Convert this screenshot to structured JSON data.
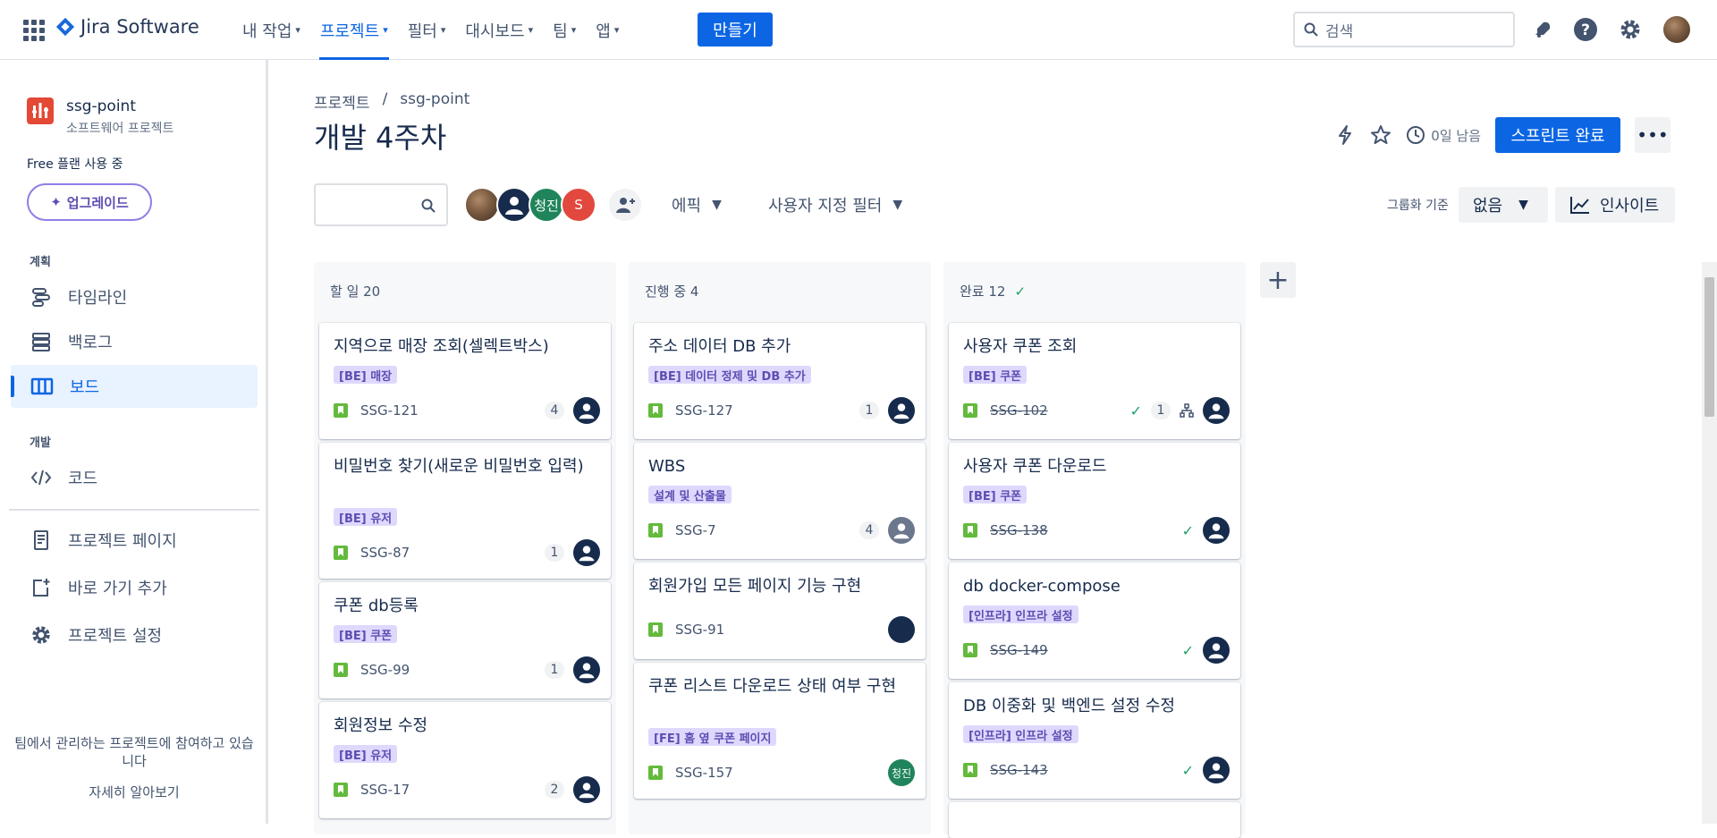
{
  "topnav": {
    "product": "Jira Software",
    "items": [
      {
        "label": "내 작업"
      },
      {
        "label": "프로젝트"
      },
      {
        "label": "필터"
      },
      {
        "label": "대시보드"
      },
      {
        "label": "팀"
      },
      {
        "label": "앱"
      }
    ],
    "active_item": "프로젝트",
    "create_label": "만들기",
    "search_placeholder": "검색"
  },
  "sidebar": {
    "project_name": "ssg-point",
    "project_type": "소프트웨어 프로젝트",
    "plan_text": "Free 플랜 사용 중",
    "upgrade_label": "업그레이드",
    "section_planning": "계획",
    "section_dev": "개발",
    "items": {
      "timeline": "타임라인",
      "backlog": "백로그",
      "board": "보드",
      "code": "코드",
      "project_page": "프로젝트 페이지",
      "add_shortcut": "바로 가기 추가",
      "project_settings": "프로젝트 설정"
    },
    "footer_text": "팀에서 관리하는 프로젝트에 참여하고 있습니다",
    "footer_link": "자세히 알아보기"
  },
  "main": {
    "breadcrumb": [
      "프로젝트",
      "ssg-point"
    ],
    "title": "개발 4주차",
    "days_left": "0일 남음",
    "complete_label": "스프린트 완료",
    "avatar_initials": [
      "청진",
      "S"
    ],
    "epic_filter": "에픽",
    "custom_filter": "사용자 지정 필터",
    "group_by_label": "그룹화 기준",
    "group_by_value": "없음",
    "insight_label": "인사이트"
  },
  "columns": [
    {
      "name": "할 일 20",
      "cards": [
        {
          "title": "지역으로 매장 조회(셀렉트박스)",
          "label": "[BE] 매장",
          "key": "SSG-121",
          "estimate": "4"
        },
        {
          "title": "비밀번호 찾기(새로운 비밀번호 입력)",
          "label": "[BE] 유저",
          "key": "SSG-87",
          "estimate": "1"
        },
        {
          "title": "쿠폰 db등록",
          "label": "[BE] 쿠폰",
          "key": "SSG-99",
          "estimate": "1"
        },
        {
          "title": "회원정보 수정",
          "label": "[BE] 유저",
          "key": "SSG-17",
          "estimate": "2"
        }
      ]
    },
    {
      "name": "진행 중 4",
      "cards": [
        {
          "title": "주소 데이터 DB 추가",
          "label": "[BE] 데이터 정제 및 DB 추가",
          "key": "SSG-127",
          "estimate": "1"
        },
        {
          "title": "WBS",
          "label": "설계 및 산출물",
          "key": "SSG-7",
          "estimate": "4"
        },
        {
          "title": "회원가입 모든 페이지 기능 구현",
          "label": "",
          "key": "SSG-91",
          "estimate": ""
        },
        {
          "title": "쿠폰 리스트 다운로드 상태 여부 구현",
          "label": "[FE] 홈 옆 쿠폰 페이지",
          "key": "SSG-157",
          "estimate": "",
          "assignee_initials": "청진"
        }
      ]
    },
    {
      "name": "완료 12",
      "cards": [
        {
          "title": "사용자 쿠폰 조회",
          "label": "[BE] 쿠폰",
          "key": "SSG-102",
          "estimate": "1"
        },
        {
          "title": "사용자 쿠폰 다운로드",
          "label": "[BE] 쿠폰",
          "key": "SSG-138",
          "estimate": ""
        },
        {
          "title": "db docker-compose",
          "label": "[인프라] 인프라 설정",
          "key": "SSG-149",
          "estimate": ""
        },
        {
          "title": "DB 이중화 및 백엔드 설정 수정",
          "label": "[인프라] 인프라 설정",
          "key": "SSG-143",
          "estimate": ""
        }
      ]
    }
  ]
}
